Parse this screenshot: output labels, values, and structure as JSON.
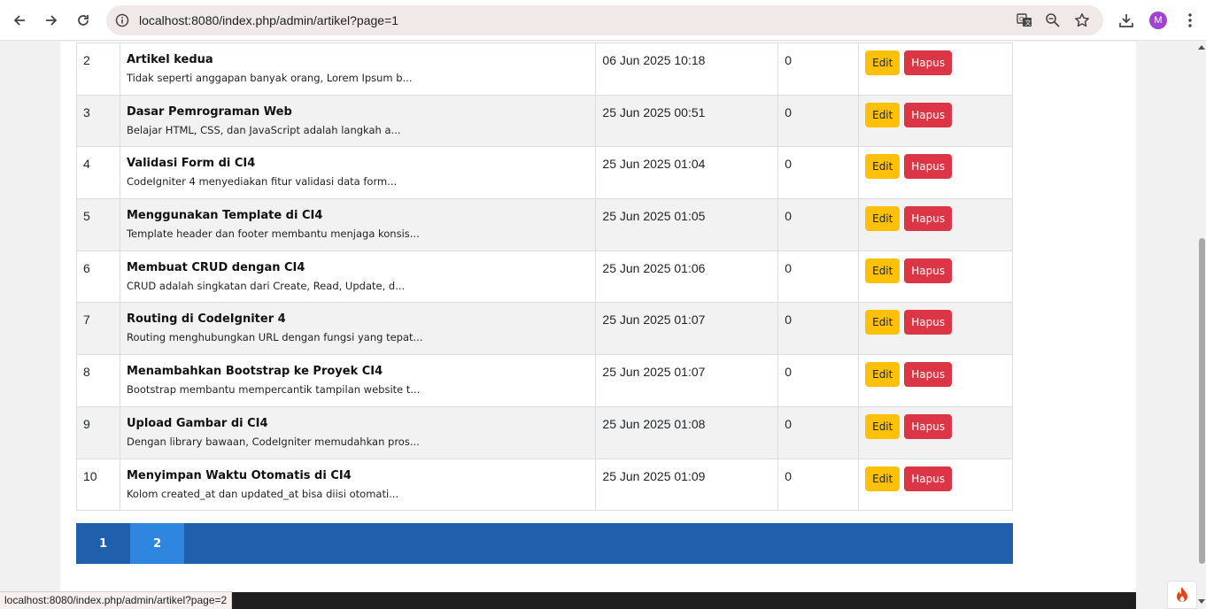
{
  "browser": {
    "url": "localhost:8080/index.php/admin/artikel?page=1",
    "profile_initial": "M",
    "status_url": "localhost:8080/index.php/admin/artikel?page=2"
  },
  "table": {
    "rows": [
      {
        "no": "2",
        "title": "Artikel kedua",
        "desc": "Tidak seperti anggapan banyak orang, Lorem Ipsum b...",
        "date": "06 Jun 2025 10:18",
        "status": "0"
      },
      {
        "no": "3",
        "title": "Dasar Pemrograman Web",
        "desc": "Belajar HTML, CSS, dan JavaScript adalah langkah a...",
        "date": "25 Jun 2025 00:51",
        "status": "0"
      },
      {
        "no": "4",
        "title": "Validasi Form di CI4",
        "desc": "CodeIgniter 4 menyediakan fitur validasi data form...",
        "date": "25 Jun 2025 01:04",
        "status": "0"
      },
      {
        "no": "5",
        "title": "Menggunakan Template di CI4",
        "desc": "Template header dan footer membantu menjaga konsis...",
        "date": "25 Jun 2025 01:05",
        "status": "0"
      },
      {
        "no": "6",
        "title": "Membuat CRUD dengan CI4",
        "desc": "CRUD adalah singkatan dari Create, Read, Update, d...",
        "date": "25 Jun 2025 01:06",
        "status": "0"
      },
      {
        "no": "7",
        "title": "Routing di CodeIgniter 4",
        "desc": "Routing menghubungkan URL dengan fungsi yang tepat...",
        "date": "25 Jun 2025 01:07",
        "status": "0"
      },
      {
        "no": "8",
        "title": "Menambahkan Bootstrap ke Proyek CI4",
        "desc": "Bootstrap membantu mempercantik tampilan website t...",
        "date": "25 Jun 2025 01:07",
        "status": "0"
      },
      {
        "no": "9",
        "title": "Upload Gambar di CI4",
        "desc": "Dengan library bawaan, CodeIgniter memudahkan pros...",
        "date": "25 Jun 2025 01:08",
        "status": "0"
      },
      {
        "no": "10",
        "title": "Menyimpan Waktu Otomatis di CI4",
        "desc": "Kolom created_at dan updated_at bisa diisi otomati...",
        "date": "25 Jun 2025 01:09",
        "status": "0"
      }
    ],
    "edit_label": "Edit",
    "delete_label": "Hapus"
  },
  "pagination": {
    "pages": [
      "1",
      "2"
    ],
    "active_page": "2"
  },
  "colors": {
    "edit": "#ffc107",
    "delete": "#dc3545",
    "pager_bg": "#1f5fac",
    "pager_active": "#2e86de"
  },
  "icons": {
    "back": "arrow-left-icon",
    "forward": "arrow-right-icon",
    "reload": "reload-icon",
    "site_info": "info-icon",
    "translate": "translate-icon",
    "zoom": "zoom-icon",
    "bookmark": "star-icon",
    "downloads": "download-icon",
    "menu": "kebab-menu-icon",
    "debug": "flame-icon"
  }
}
